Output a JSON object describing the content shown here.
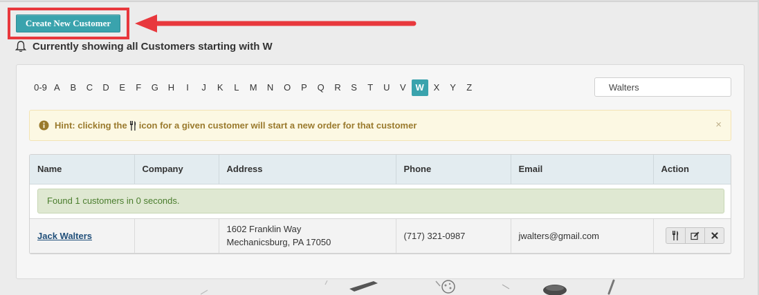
{
  "toolbar": {
    "create_label": "Create New Customer"
  },
  "heading": {
    "text": "Currently showing all Customers starting with W",
    "icon": "bell-icon"
  },
  "alphabet": {
    "letters": [
      "0-9",
      "A",
      "B",
      "C",
      "D",
      "E",
      "F",
      "G",
      "H",
      "I",
      "J",
      "K",
      "L",
      "M",
      "N",
      "O",
      "P",
      "Q",
      "R",
      "S",
      "T",
      "U",
      "V",
      "W",
      "X",
      "Y",
      "Z"
    ],
    "active": "W"
  },
  "search": {
    "value": "Walters"
  },
  "hint": {
    "before": "Hint: clicking the",
    "after": "icon for a given customer will start a new order for that customer",
    "close": "×"
  },
  "table": {
    "columns": [
      "Name",
      "Company",
      "Address",
      "Phone",
      "Email",
      "Action"
    ],
    "status": "Found 1 customers in 0 seconds.",
    "rows": [
      {
        "name": "Jack Walters",
        "company": "",
        "address_line1": "1602 Franklin Way",
        "address_line2": "Mechanicsburg, PA 17050",
        "phone": "(717) 321-0987",
        "email": "jwalters@gmail.com"
      }
    ]
  },
  "colors": {
    "accent": "#3aa3ad",
    "highlight": "#e8383d",
    "hint_bg": "#fcf8e3",
    "success_bg": "#dfe8d2"
  }
}
